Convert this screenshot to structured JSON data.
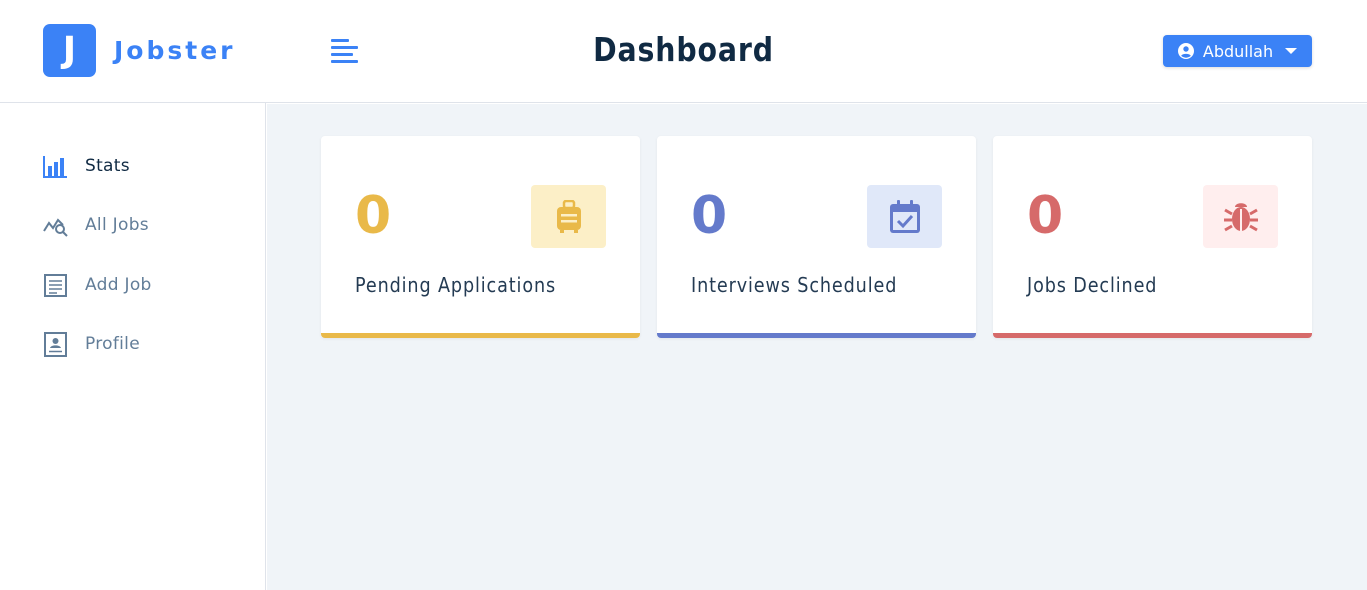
{
  "brand": {
    "logo_letter": "J",
    "name": "Jobster"
  },
  "header": {
    "title": "Dashboard",
    "user_name": "Abdullah"
  },
  "sidebar": {
    "items": [
      {
        "label": "Stats",
        "icon": "bar-chart-icon",
        "active": true
      },
      {
        "label": "All Jobs",
        "icon": "search-chart-icon",
        "active": false
      },
      {
        "label": "Add Job",
        "icon": "form-icon",
        "active": false
      },
      {
        "label": "Profile",
        "icon": "profile-card-icon",
        "active": false
      }
    ]
  },
  "stats": [
    {
      "count": "0",
      "label": "Pending Applications",
      "icon": "suitcase-icon",
      "color": "#e9b949",
      "bg": "#fcefc7"
    },
    {
      "count": "0",
      "label": "Interviews Scheduled",
      "icon": "calendar-check-icon",
      "color": "#647acb",
      "bg": "#e0e8f9"
    },
    {
      "count": "0",
      "label": "Jobs Declined",
      "icon": "bug-icon",
      "color": "#d66a6a",
      "bg": "#ffeeee"
    }
  ],
  "colors": {
    "primary": "#3b82f6",
    "background": "#f0f4f8",
    "text_dark": "#102a43",
    "text_muted": "#627d98"
  }
}
